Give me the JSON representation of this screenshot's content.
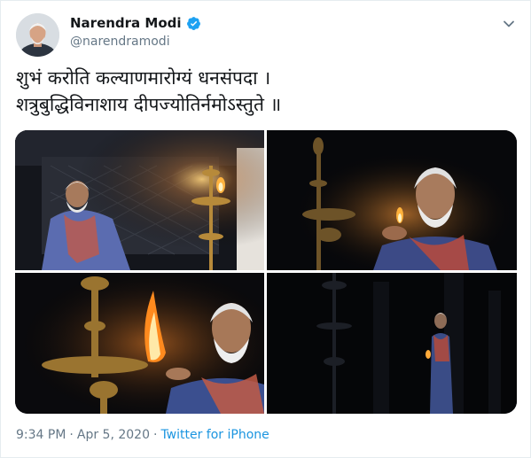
{
  "tweet": {
    "author": {
      "display_name": "Narendra Modi",
      "handle": "@narendramodi",
      "verified": true
    },
    "text_lines": [
      "शुभं करोति कल्याणमारोग्यं धनसंपदा ।",
      "शत्रुबुद्धिविनाशाय दीपज्योतिर्नमोऽस्तुते ॥"
    ],
    "media": [
      {
        "subject": "man beside lit lamp at night (wide)"
      },
      {
        "subject": "man with lamp close-up"
      },
      {
        "subject": "hand lighting lamp flame close-up"
      },
      {
        "subject": "man holding lamp in darkness (far)"
      }
    ],
    "meta": {
      "time": "9:34 PM",
      "separator": "·",
      "date": "Apr 5, 2020",
      "source": "Twitter for iPhone"
    }
  },
  "colors": {
    "verified_blue": "#1da1f2",
    "link_blue": "#1b95e0",
    "secondary_text": "#657786"
  },
  "icons": {
    "verified": "verified-badge-icon",
    "menu": "chevron-down-icon"
  }
}
